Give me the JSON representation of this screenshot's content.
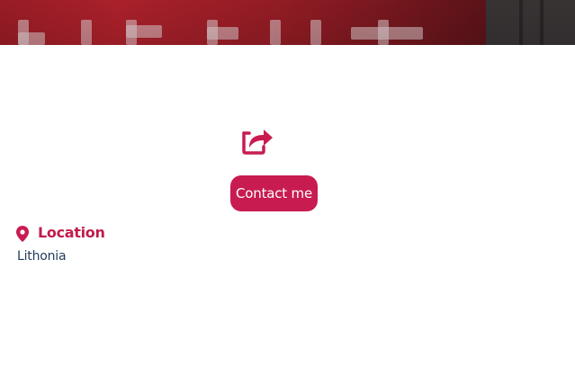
{
  "banner": {
    "image": "cover-photo"
  },
  "actions": {
    "share_icon": "share-icon",
    "contact_label": "Contact me"
  },
  "location": {
    "icon": "map-pin-icon",
    "title": "Location",
    "value": "Lithonia"
  },
  "colors": {
    "accent": "#c81c50",
    "heading": "#c01c4c",
    "text": "#1e3a5c",
    "background": "#ffffff"
  }
}
